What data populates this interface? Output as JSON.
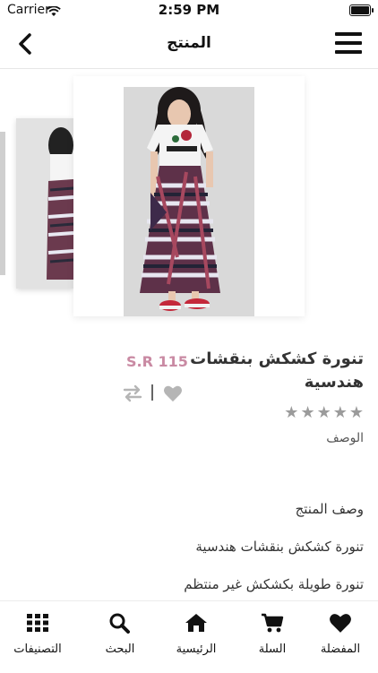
{
  "status": {
    "carrier": "Carrier",
    "time": "2:59 PM"
  },
  "header": {
    "title": "المنتج"
  },
  "product": {
    "name": "تنورة كشكش بنقشات هندسية",
    "price": "S.R 115",
    "rating": 0,
    "description_label": "الوصف",
    "description_lines": [
      "وصف المنتج",
      "تنورة كشكش بنقشات هندسية",
      "تنورة طويلة بكشكش غير منتظم"
    ]
  },
  "tabs": [
    {
      "label": "المفضلة",
      "icon": "heart-icon"
    },
    {
      "label": "السلة",
      "icon": "cart-icon"
    },
    {
      "label": "الرئيسية",
      "icon": "home-icon"
    },
    {
      "label": "البحث",
      "icon": "search-icon"
    },
    {
      "label": "التصنيفات",
      "icon": "grid-icon"
    }
  ],
  "colors": {
    "price": "#c98aa3",
    "star": "#9b9b9b",
    "icon": "#111111"
  }
}
